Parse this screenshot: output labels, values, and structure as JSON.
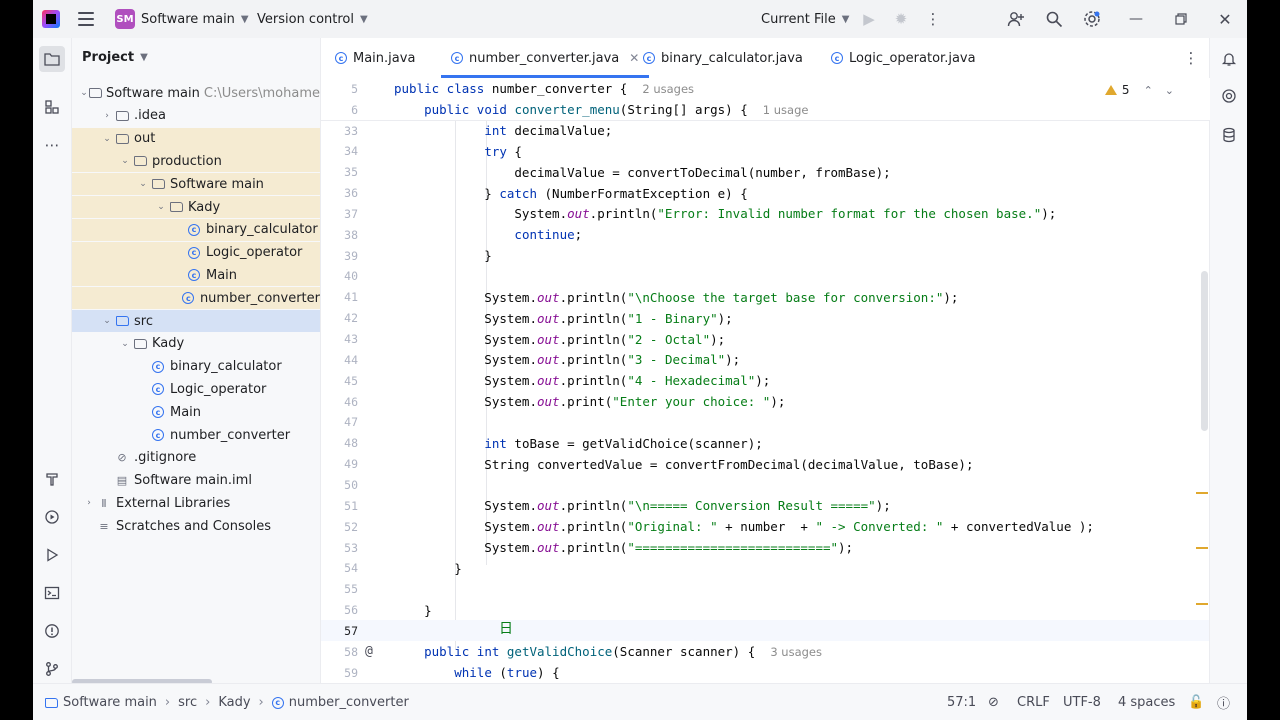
{
  "titlebar": {
    "project_badge": "SM",
    "project_name": "Software main",
    "vcs": "Version control",
    "run_config": "Current File"
  },
  "project_panel": {
    "title": "Project",
    "tree": [
      {
        "depth": 0,
        "arrow": "down",
        "icon": "folder",
        "label": "Software main",
        "hint": "C:\\Users\\mohame",
        "excluded": false
      },
      {
        "depth": 1,
        "arrow": "right",
        "icon": "folder",
        "label": ".idea",
        "excluded": false
      },
      {
        "depth": 1,
        "arrow": "down",
        "icon": "folder",
        "label": "out",
        "excluded": true
      },
      {
        "depth": 2,
        "arrow": "down",
        "icon": "folder",
        "label": "production",
        "excluded": true
      },
      {
        "depth": 3,
        "arrow": "down",
        "icon": "folder",
        "label": "Software main",
        "excluded": true
      },
      {
        "depth": 4,
        "arrow": "down",
        "icon": "folder",
        "label": "Kady",
        "excluded": true
      },
      {
        "depth": 5,
        "arrow": "none",
        "icon": "class",
        "label": "binary_calculator",
        "excluded": true
      },
      {
        "depth": 5,
        "arrow": "none",
        "icon": "class",
        "label": "Logic_operator",
        "excluded": true
      },
      {
        "depth": 5,
        "arrow": "none",
        "icon": "class",
        "label": "Main",
        "excluded": true
      },
      {
        "depth": 5,
        "arrow": "none",
        "icon": "class",
        "label": "number_converter",
        "excluded": true
      },
      {
        "depth": 1,
        "arrow": "down",
        "icon": "folder-blue",
        "label": "src",
        "selected": true
      },
      {
        "depth": 2,
        "arrow": "down",
        "icon": "package",
        "label": "Kady"
      },
      {
        "depth": 3,
        "arrow": "none",
        "icon": "class",
        "label": "binary_calculator"
      },
      {
        "depth": 3,
        "arrow": "none",
        "icon": "class",
        "label": "Logic_operator"
      },
      {
        "depth": 3,
        "arrow": "none",
        "icon": "class",
        "label": "Main"
      },
      {
        "depth": 3,
        "arrow": "none",
        "icon": "class",
        "label": "number_converter"
      },
      {
        "depth": 1,
        "arrow": "none",
        "icon": "ignore",
        "label": ".gitignore"
      },
      {
        "depth": 1,
        "arrow": "none",
        "icon": "module",
        "label": "Software main.iml"
      },
      {
        "depth": 0,
        "arrow": "right",
        "icon": "library",
        "label": "External Libraries"
      },
      {
        "depth": 0,
        "arrow": "none",
        "icon": "scratch",
        "label": "Scratches and Consoles"
      }
    ]
  },
  "tabs": [
    {
      "label": "Main.java",
      "active": false,
      "closable": false
    },
    {
      "label": "number_converter.java",
      "active": true,
      "closable": true
    },
    {
      "label": "binary_calculator.java",
      "active": false,
      "closable": false
    },
    {
      "label": "Logic_operator.java",
      "active": false,
      "closable": false
    }
  ],
  "editor": {
    "warnings": "5",
    "sticky": [
      {
        "ln": "5",
        "html": "<span class='kw'>public class</span> number_converter {  <span class='ph'>2 usages</span>"
      },
      {
        "ln": "6",
        "html": "    <span class='kw'>public void</span> <span class='fn'>converter_menu</span>(String[] args) {  <span class='ph'>1 usage</span>"
      }
    ],
    "lines": [
      {
        "ln": "33",
        "html": "            <span class='kw'>int</span> decimalValue;"
      },
      {
        "ln": "34",
        "html": "            <span class='kw'>try</span> {"
      },
      {
        "ln": "35",
        "html": "                decimalValue = convertToDecimal(number, fromBase);"
      },
      {
        "ln": "36",
        "html": "            } <span class='kw'>catch</span> (NumberFormatException e) {"
      },
      {
        "ln": "37",
        "html": "                System.<span class='st'>out</span>.println(<span class='str'>\"Error: Invalid number format for the chosen base.\"</span>);"
      },
      {
        "ln": "38",
        "html": "                <span class='kw'>continue</span>;"
      },
      {
        "ln": "39",
        "html": "            }"
      },
      {
        "ln": "40",
        "html": ""
      },
      {
        "ln": "41",
        "html": "            System.<span class='st'>out</span>.println(<span class='str'>\"\\nChoose the target base for conversion:\"</span>);"
      },
      {
        "ln": "42",
        "html": "            System.<span class='st'>out</span>.println(<span class='str'>\"1 - Binary\"</span>);"
      },
      {
        "ln": "43",
        "html": "            System.<span class='st'>out</span>.println(<span class='str'>\"2 - Octal\"</span>);"
      },
      {
        "ln": "44",
        "html": "            System.<span class='st'>out</span>.println(<span class='str'>\"3 - Decimal\"</span>);"
      },
      {
        "ln": "45",
        "html": "            System.<span class='st'>out</span>.println(<span class='str'>\"4 - Hexadecimal\"</span>);"
      },
      {
        "ln": "46",
        "html": "            System.<span class='st'>out</span>.print(<span class='str'>\"Enter your choice: \"</span>);"
      },
      {
        "ln": "47",
        "html": ""
      },
      {
        "ln": "48",
        "html": "            <span class='kw'>int</span> toBase = getValidChoice(scanner);"
      },
      {
        "ln": "49",
        "html": "            String convertedValue = convertFromDecimal(decimalValue, toBase);"
      },
      {
        "ln": "50",
        "html": ""
      },
      {
        "ln": "51",
        "html": "            System.<span class='st'>out</span>.println(<span class='str'>\"\\n===== Conversion Result =====\"</span>);"
      },
      {
        "ln": "52",
        "html": "            System.<span class='st'>out</span>.println(<span class='str'>\"Original: \"</span> + number  + <span class='str'>\" -> Converted: \"</span> + convertedValue );"
      },
      {
        "ln": "53",
        "html": "            System.<span class='st'>out</span>.println(<span class='str'>\"==========================\"</span>);"
      },
      {
        "ln": "54",
        "html": "        }"
      },
      {
        "ln": "55",
        "html": ""
      },
      {
        "ln": "56",
        "html": "    }"
      },
      {
        "ln": "57",
        "html": "",
        "current": true
      },
      {
        "ln": "58",
        "html": "    <span class='kw'>public int</span> <span class='fn'>getValidChoice</span>(Scanner scanner) {  <span class='ph'>3 usages</span>",
        "at": true
      },
      {
        "ln": "59",
        "html": "        <span class='kw'>while</span> (<span class='kw'>true</span>) {"
      }
    ]
  },
  "statusbar": {
    "breadcrumb": [
      "Software main",
      "src",
      "Kady",
      "number_converter"
    ],
    "position": "57:1",
    "line_sep": "CRLF",
    "encoding": "UTF-8",
    "indent": "4 spaces"
  }
}
